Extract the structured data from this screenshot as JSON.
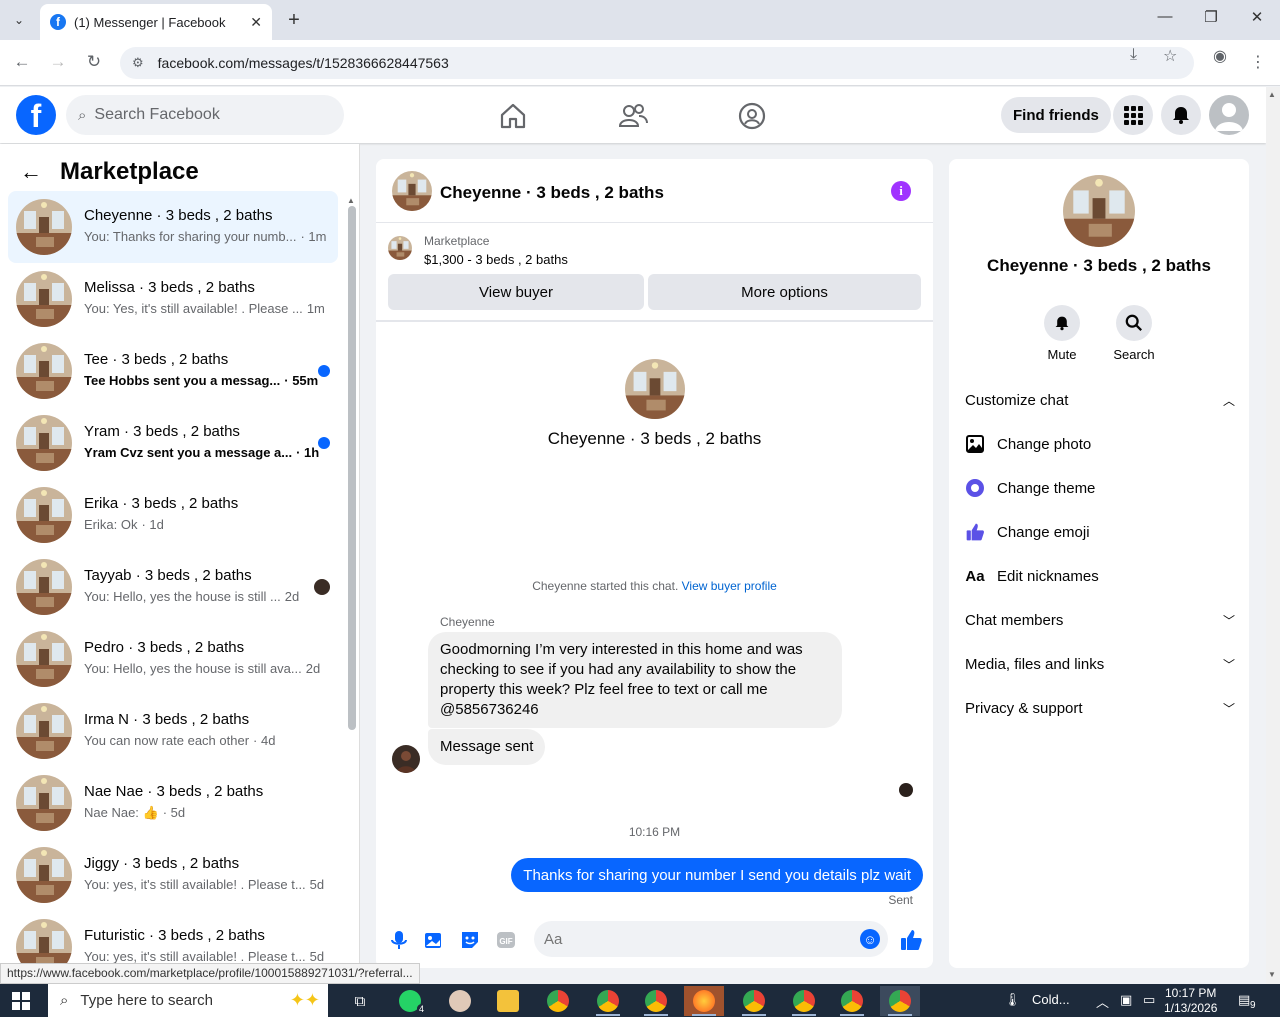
{
  "browser": {
    "tab_title": "(1) Messenger | Facebook",
    "url": "facebook.com/messages/t/1528366628447563",
    "status_url": "https://www.facebook.com/marketplace/profile/100015889271031/?referral..."
  },
  "fb_header": {
    "search_placeholder": "Search Facebook",
    "find_friends": "Find friends"
  },
  "left": {
    "title": "Marketplace",
    "conversations": [
      {
        "name": "Cheyenne · 3 beds , 2 baths",
        "snippet": "You: Thanks for sharing your numb...",
        "time": "· 1m",
        "unread": false,
        "active": true
      },
      {
        "name": "Melissa · 3 beds , 2 baths",
        "snippet": "You: Yes, it's still available! . Please ...",
        "time": "1m",
        "unread": false,
        "active": false
      },
      {
        "name": "Tee · 3 beds , 2 baths",
        "snippet": "Tee Hobbs sent you a messag...",
        "time": "· 55m",
        "unread": true,
        "active": false
      },
      {
        "name": "Yram · 3 beds , 2 baths",
        "snippet": "Yram Cvz sent you a message a...",
        "time": "· 1h",
        "unread": true,
        "active": false
      },
      {
        "name": "Erika · 3 beds , 2 baths",
        "snippet": "Erika: Ok",
        "time": "· 1d",
        "unread": false,
        "active": false
      },
      {
        "name": "Tayyab · 3 beds , 2 baths",
        "snippet": "You: Hello, yes the house is still ...",
        "time": "2d",
        "unread": false,
        "active": false,
        "seen": true
      },
      {
        "name": "Pedro · 3 beds , 2 baths",
        "snippet": "You: Hello, yes the house is still ava...",
        "time": "2d",
        "unread": false,
        "active": false
      },
      {
        "name": "Irma N · 3 beds , 2 baths",
        "snippet": "You can now rate each other",
        "time": "· 4d",
        "unread": false,
        "active": false
      },
      {
        "name": "Nae Nae · 3 beds , 2 baths",
        "snippet": "Nae Nae: 👍",
        "time": "· 5d",
        "unread": false,
        "active": false
      },
      {
        "name": "Jiggy · 3 beds , 2 baths",
        "snippet": "You: yes, it's still available! . Please t...",
        "time": "5d",
        "unread": false,
        "active": false
      },
      {
        "name": "Futuristic · 3 beds , 2 baths",
        "snippet": "You: yes, it's still available! . Please t...",
        "time": "5d",
        "unread": false,
        "active": false
      }
    ]
  },
  "chat": {
    "title": "Cheyenne · 3 beds , 2 baths",
    "marketplace_label": "Marketplace",
    "listing": "$1,300 - 3 beds , 2 baths",
    "view_buyer": "View buyer",
    "more_options": "More options",
    "center_name": "Cheyenne · 3 beds , 2 baths",
    "started_text": "Cheyenne started this chat.",
    "view_buyer_profile": "View buyer profile",
    "sender": "Cheyenne",
    "incoming_message": "Goodmorning I’m very interested in this home and was checking to see if you had any availability to show the property this week? Plz feel free to text or call me @5856736246",
    "incoming_message_2": "Message sent",
    "timestamp": "10:16 PM",
    "outgoing_message": "Thanks for sharing your number I send you details plz wait",
    "sent_label": "Sent",
    "input_placeholder": "Aa"
  },
  "right": {
    "name": "Cheyenne · 3 beds , 2 baths",
    "mute": "Mute",
    "search": "Search",
    "customize": "Customize chat",
    "change_photo": "Change photo",
    "change_theme": "Change theme",
    "change_emoji": "Change emoji",
    "edit_nicknames": "Edit nicknames",
    "chat_members": "Chat members",
    "media": "Media, files and links",
    "privacy": "Privacy & support"
  },
  "taskbar": {
    "search_placeholder": "Type here to search",
    "weather": "Cold...",
    "time": "10:17 PM",
    "date": "1/13/2026",
    "whatsapp_badge": "4",
    "notif_count": "9"
  },
  "colors": {
    "fb_blue": "#0866ff",
    "info_purple": "#a033ff",
    "active_conv": "#ebf5ff"
  }
}
